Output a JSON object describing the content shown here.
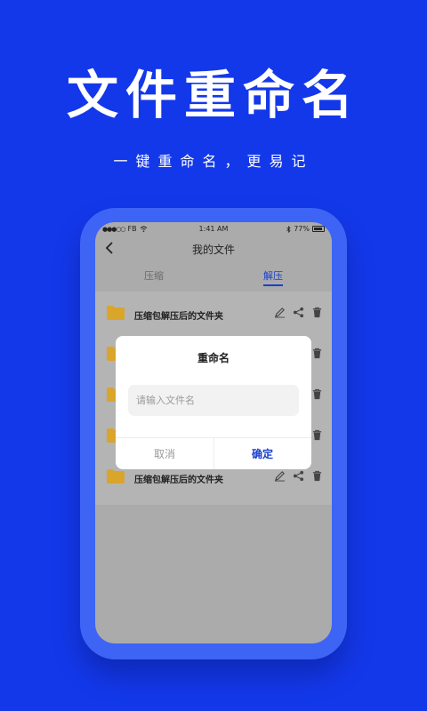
{
  "banner": {
    "headline": "文件重命名",
    "subline": "一键重命名，更易记"
  },
  "status_bar": {
    "carrier": "FB",
    "time": "1:41 AM",
    "battery": "77%"
  },
  "nav": {
    "title": "我的文件"
  },
  "tabs": [
    {
      "label": "压缩",
      "active": false
    },
    {
      "label": "解压",
      "active": true
    }
  ],
  "file_list": [
    {
      "name": "压缩包解压后的文件夹"
    },
    {
      "name": ""
    },
    {
      "name": ""
    },
    {
      "name": ""
    },
    {
      "name": "压缩包解压后的文件夹"
    }
  ],
  "dialog": {
    "title": "重命名",
    "input_placeholder": "请输入文件名",
    "input_value": "",
    "cancel_label": "取消",
    "confirm_label": "确定"
  },
  "colors": {
    "background": "#1338ea",
    "phone_frame": "#3d64f5",
    "accent": "#1a3fd0",
    "folder": "#d9a52b"
  },
  "icons": [
    "back-chevron-icon",
    "folder-icon",
    "edit-pencil-icon",
    "share-icon",
    "trash-icon",
    "wifi-icon",
    "bluetooth-icon",
    "battery-icon"
  ]
}
